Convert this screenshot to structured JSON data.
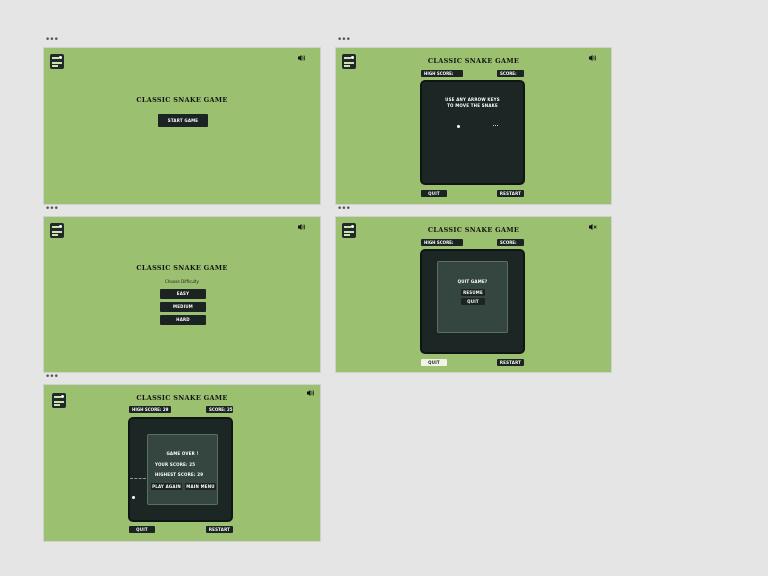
{
  "window_dots": "•••",
  "game_title": "CLASSIC SNAKE GAME",
  "start_screen": {
    "start_button": "START GAME"
  },
  "difficulty_screen": {
    "subtitle": "Choose Difficulty",
    "options": [
      "EASY",
      "MEDIUM",
      "HARD"
    ]
  },
  "play_screen": {
    "high_score_label": "HIGH SCORE:",
    "score_label": "SCORE:",
    "instructions": [
      "USE ANY ARROW KEYS",
      "TO MOVE THE SNAKE"
    ],
    "quit_button": "QUIT",
    "restart_button": "RESTART"
  },
  "quit_screen": {
    "high_score_label": "HIGH SCORE:",
    "score_label": "SCORE:",
    "dialog_title": "QUIT GAME?",
    "resume_button": "RESUME",
    "quit_button": "QUIT",
    "bottom_quit": "QUIT",
    "bottom_restart": "RESTART"
  },
  "gameover_screen": {
    "high_score_text": "HIGH SCORE: 29",
    "score_text": "SCORE: 25",
    "dialog_title": "GAME OVER !",
    "your_score": "YOUR SCORE: 25",
    "highest_score": "HIGHEST SCORE: 29",
    "play_again_button": "PLAY AGAIN",
    "main_menu_button": "MAIN MENU",
    "quit_button": "QUIT",
    "restart_button": "RESTART"
  },
  "icons": {
    "logo": "snake-logo-icon",
    "sound_on": "speaker-on-icon",
    "sound_off": "speaker-muted-icon"
  },
  "colors": {
    "background": "#9bc06f",
    "board": "#1b2625",
    "button": "#1b2422"
  }
}
